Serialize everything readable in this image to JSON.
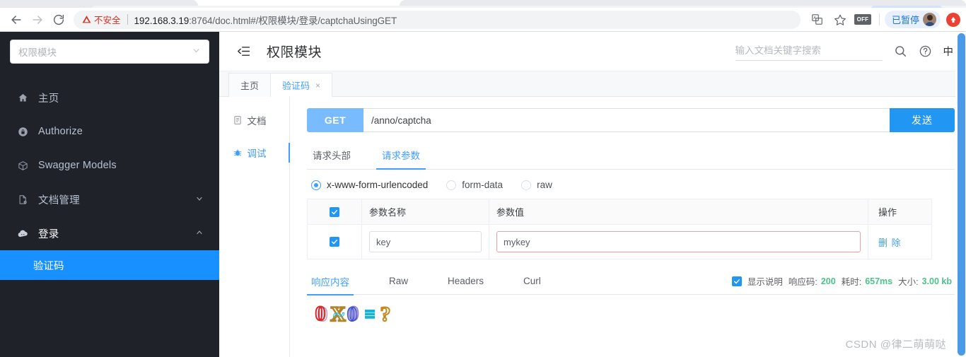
{
  "browser": {
    "back_label": "back-arrow",
    "forward_label": "forward-arrow",
    "reload_label": "reload",
    "security_label": "不安全",
    "url_host": "192.168.3.19",
    "url_rest": ":8764/doc.html#/权限模块/登录/captchaUsingGET",
    "translate_icon": "translate-icon",
    "bookmark_icon": "star-icon",
    "extension_badge": "OFF",
    "profile_label": "已暂停",
    "update_icon": "update-arrow-icon"
  },
  "sidebar": {
    "module_select": {
      "value": "权限模块",
      "chevron": "∨"
    },
    "items": [
      {
        "label": "主页",
        "icon": "home-icon",
        "arrow": ""
      },
      {
        "label": "Authorize",
        "icon": "lock-icon",
        "arrow": ""
      },
      {
        "label": "Swagger Models",
        "icon": "cube-icon",
        "arrow": ""
      },
      {
        "label": "文档管理",
        "icon": "document-gear-icon",
        "arrow": "∨"
      },
      {
        "label": "登录",
        "icon": "cloud-icon",
        "arrow": "∧"
      }
    ],
    "submenu": [
      {
        "label": "验证码",
        "active": true
      }
    ]
  },
  "header": {
    "menu_icon": "collapse-menu-icon",
    "title": "权限模块",
    "search_placeholder": "输入文档关键字搜索",
    "search_value": "",
    "search_icon": "search-icon",
    "help_icon": "question-circle-icon",
    "lang_label": "中"
  },
  "doc_tabs": [
    {
      "label": "主页",
      "active": false,
      "closable": false
    },
    {
      "label": "验证码",
      "active": true,
      "closable": true,
      "close_glyph": "×"
    }
  ],
  "vertical_tabs": [
    {
      "label": "文档",
      "icon": "document-icon",
      "active": false
    },
    {
      "label": "调试",
      "icon": "bug-icon",
      "active": true
    }
  ],
  "request": {
    "method": "GET",
    "url": "/anno/captcha",
    "send_label": "发送",
    "tabs": [
      {
        "label": "请求头部",
        "active": false
      },
      {
        "label": "请求参数",
        "active": true
      }
    ],
    "body_types": [
      {
        "label": "x-www-form-urlencoded",
        "checked": true
      },
      {
        "label": "form-data",
        "checked": false
      },
      {
        "label": "raw",
        "checked": false
      }
    ],
    "table": {
      "headers": [
        "",
        "参数名称",
        "参数值",
        "操作"
      ],
      "header_checked": true,
      "rows": [
        {
          "checked": true,
          "name": "key",
          "value": "mykey",
          "action": "删 除",
          "value_error": true
        }
      ]
    }
  },
  "response": {
    "tabs": [
      {
        "label": "响应内容",
        "active": true
      },
      {
        "label": "Raw",
        "active": false
      },
      {
        "label": "Headers",
        "active": false
      },
      {
        "label": "Curl",
        "active": false
      }
    ],
    "show_desc_label": "显示说明",
    "show_desc_checked": true,
    "metrics": [
      {
        "label": "响应码:",
        "value": "200"
      },
      {
        "label": "耗时:",
        "value": "657ms"
      },
      {
        "label": "大小:",
        "value": "3.00 kb"
      }
    ],
    "captcha_alt": "captcha-image",
    "captcha_chars": [
      {
        "char": "0",
        "color": "#d42a2a"
      },
      {
        "char": "X",
        "color": "#b5822a"
      },
      {
        "char": "0",
        "color": "#6a5ad8"
      },
      {
        "char": "≡",
        "color": "#15b4d4"
      },
      {
        "char": "?",
        "color": "#c28a1f"
      }
    ]
  },
  "watermark": "CSDN @律二萌萌哒",
  "colors": {
    "accent": "#409eff",
    "send_button": "#2196f3",
    "method_badge": "#79bbff",
    "sidebar_bg": "#20222a",
    "active_submenu": "#1890ff",
    "metric_green": "#4cc38a",
    "insecure_red": "#d93025",
    "scrollbar": "#4a9ae8"
  }
}
